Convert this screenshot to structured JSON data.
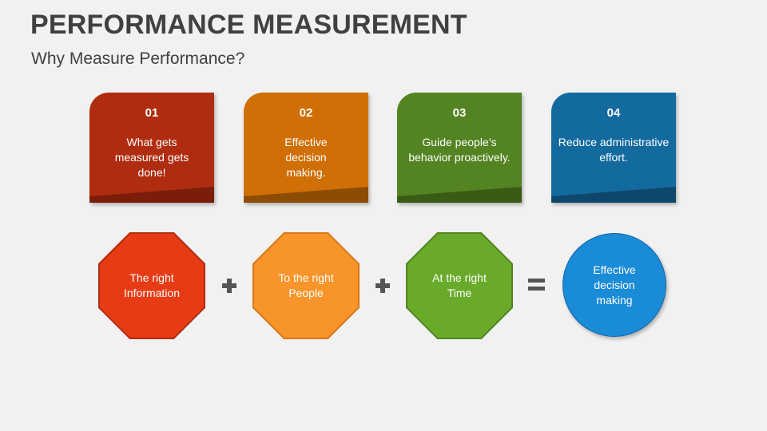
{
  "header": {
    "title": "PERFORMANCE MEASUREMENT",
    "subtitle": "Why Measure Performance?"
  },
  "cards": [
    {
      "number": "01",
      "text": "What gets measured gets done!",
      "color": "#b02c10",
      "strip_color": "#7a1e0a"
    },
    {
      "number": "02",
      "text": "Effective decision making.",
      "color": "#d06f06",
      "strip_color": "#8d4c04"
    },
    {
      "number": "03",
      "text": "Guide people’s behavior proactively.",
      "color": "#548421",
      "strip_color": "#3a5b16"
    },
    {
      "number": "04",
      "text": "Reduce administrative effort.",
      "color": "#136a9f",
      "strip_color": "#0e476b"
    }
  ],
  "equation": {
    "terms": [
      {
        "text": "The right Information",
        "color": "#e63b14",
        "border": "#b12c0c"
      },
      {
        "text": "To the right People",
        "color": "#f7942a",
        "border": "#d8781a"
      },
      {
        "text": "At the right Time",
        "color": "#6aaa2a",
        "border": "#4f8520"
      }
    ],
    "operators": [
      "plus",
      "plus",
      "equals"
    ],
    "result": {
      "text": "Effective decision making",
      "color": "#1a8bd6"
    }
  }
}
